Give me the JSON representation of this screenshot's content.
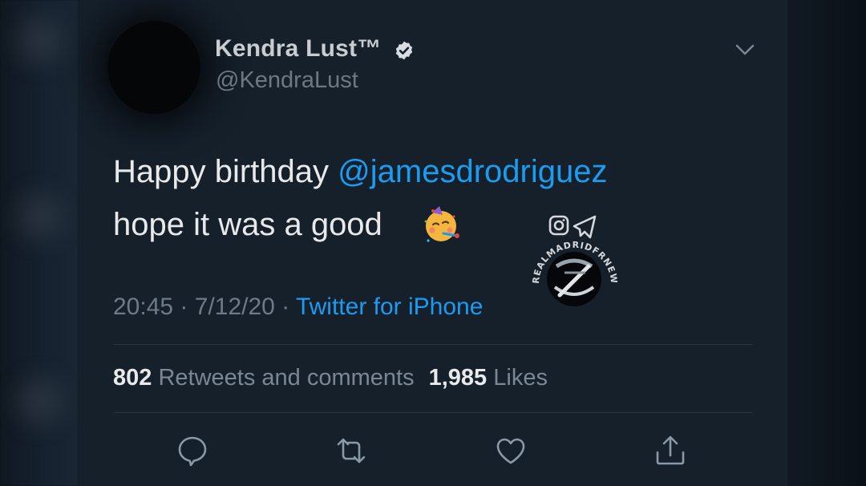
{
  "author": {
    "display_name": "Kendra Lust™",
    "handle": "@KendraLust",
    "verified": true
  },
  "tweet": {
    "text_prefix": "Happy birthday ",
    "mention": "@jamesdrodriguez",
    "line2": "hope it was a good ",
    "emoji": "partying-face-icon"
  },
  "meta": {
    "time": "20:45",
    "separator": " · ",
    "date": "7/12/20",
    "source": "Twitter for iPhone"
  },
  "stats": {
    "retweets_count": "802",
    "retweets_label": "Retweets and comments",
    "likes_count": "1,985",
    "likes_label": "Likes"
  },
  "watermark": {
    "text": "REALMADRIDFRNEWS"
  },
  "colors": {
    "background": "#15202b",
    "accent": "#1d9bf0",
    "text": "#e7e9ea",
    "muted": "#6e7a86"
  }
}
